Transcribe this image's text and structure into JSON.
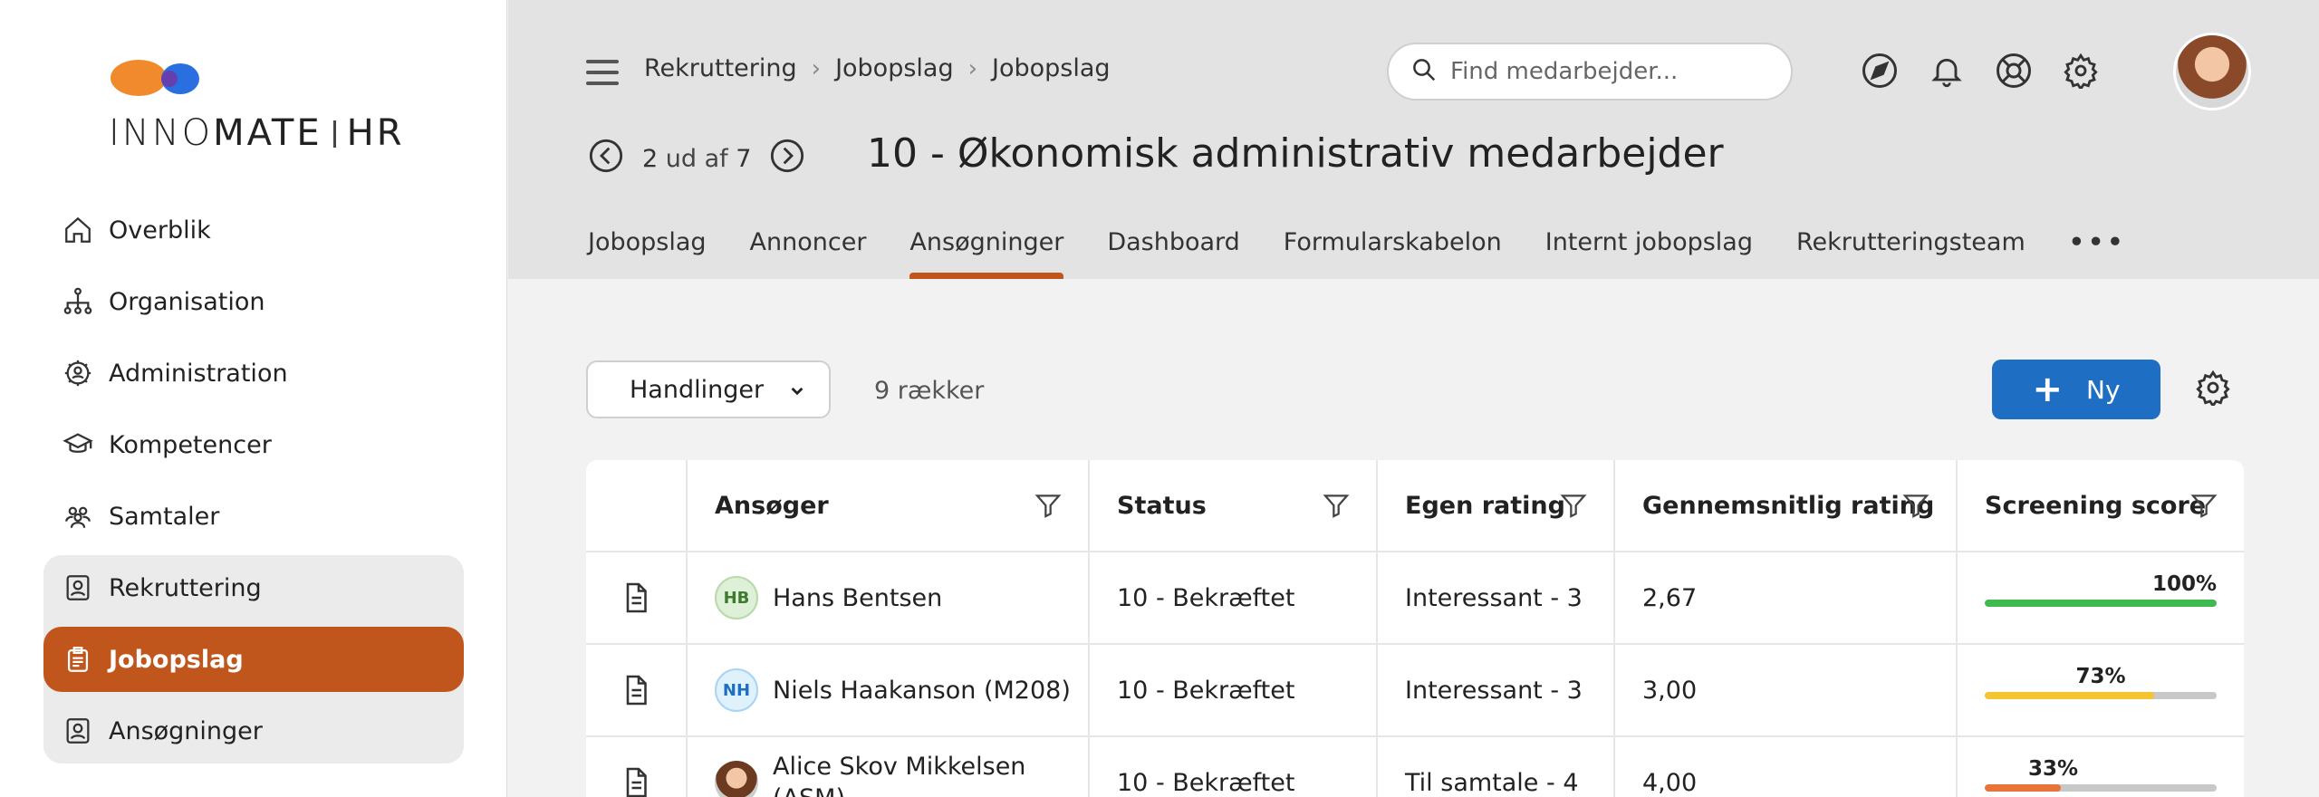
{
  "brand": {
    "name_light": "INNO",
    "name_bold": "MATE",
    "suffix": "HR"
  },
  "sidebar": {
    "items": [
      {
        "label": "Overblik",
        "icon": "home-icon"
      },
      {
        "label": "Organisation",
        "icon": "org-chart-icon"
      },
      {
        "label": "Administration",
        "icon": "gear-user-icon"
      },
      {
        "label": "Kompetencer",
        "icon": "graduation-cap-icon"
      },
      {
        "label": "Samtaler",
        "icon": "people-icon"
      },
      {
        "label": "Rekruttering",
        "icon": "id-badge-icon"
      },
      {
        "label": "Jobopslag",
        "icon": "job-post-icon"
      },
      {
        "label": "Ansøgninger",
        "icon": "id-badge-icon"
      }
    ]
  },
  "header": {
    "breadcrumbs": [
      "Rekruttering",
      "Jobopslag",
      "Jobopslag"
    ],
    "search_placeholder": "Find medarbejder...",
    "pager": {
      "current": "2",
      "of_text": "ud af",
      "total": "7"
    },
    "title": "10 - Økonomisk administrativ medarbejder",
    "tabs": [
      "Jobopslag",
      "Annoncer",
      "Ansøgninger",
      "Dashboard",
      "Formularskabelon",
      "Internt jobopslag",
      "Rekrutteringsteam",
      "•••"
    ],
    "active_tab": "Ansøgninger"
  },
  "toolbar": {
    "actions_label": "Handlinger",
    "row_count": "9 rækker",
    "new_label": "Ny"
  },
  "table": {
    "columns": [
      "Ansøger",
      "Status",
      "Egen rating",
      "Gennemsnitlig rating",
      "Screening score"
    ],
    "rows": [
      {
        "initials": "HB",
        "name": "Hans Bentsen",
        "status": "10 - Bekræftet",
        "own_rating": "Interessant - 3",
        "avg_rating": "2,67",
        "score": "100%",
        "score_value": 1.0,
        "score_color": "#3fba4f"
      },
      {
        "initials": "NH",
        "name": "Niels Haakanson (M208)",
        "status": "10 - Bekræftet",
        "own_rating": "Interessant - 3",
        "avg_rating": "3,00",
        "score": "73%",
        "score_value": 0.73,
        "score_color": "#f5c431"
      },
      {
        "initials": "",
        "name": "Alice Skov Mikkelsen",
        "name_line2": "(ASM)",
        "status": "10 - Bekræftet",
        "own_rating": "Til samtale - 4",
        "avg_rating": "4,00",
        "score": "33%",
        "score_value": 0.33,
        "score_color": "#e8743a"
      }
    ]
  },
  "colors": {
    "accent": "#c0561b",
    "primary": "#1e6fc4"
  }
}
